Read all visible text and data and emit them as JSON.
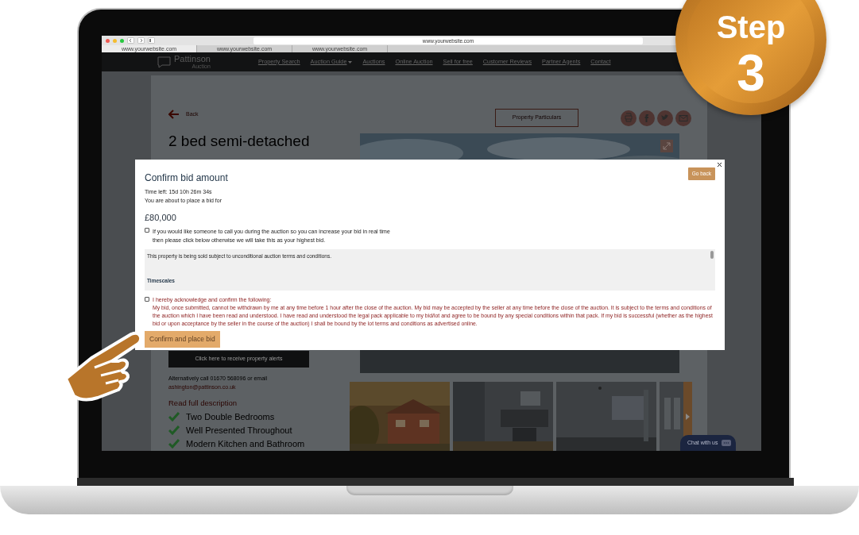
{
  "browser": {
    "url": "www.yourwebsite.com",
    "tabs": [
      {
        "label": "www.yourwebsite.com",
        "selected": true
      },
      {
        "label": "www.yourwebsite.com",
        "selected": false
      },
      {
        "label": "www.yourwebsite.com",
        "selected": false
      }
    ]
  },
  "site_nav": {
    "logo_name": "Pattinson",
    "logo_tagline": "Auction",
    "links": [
      {
        "label": "Property Search",
        "dropdown": false
      },
      {
        "label": "Auction Guide",
        "dropdown": true
      },
      {
        "label": "Auctions",
        "dropdown": false
      },
      {
        "label": "Online Auction",
        "dropdown": false
      },
      {
        "label": "Sell for free",
        "dropdown": false
      },
      {
        "label": "Customer Reviews",
        "dropdown": false
      },
      {
        "label": "Partner Agents",
        "dropdown": false
      },
      {
        "label": "Contact",
        "dropdown": false
      }
    ]
  },
  "listing": {
    "back": "Back",
    "particulars_button": "Property Particulars",
    "title": "2 bed semi-detached",
    "alerts_button": "Click here to receive property alerts",
    "contact_text": "Alternatively call 01670 568096 or email",
    "email": "ashington@pattinson.co.uk",
    "read_more": "Read full description",
    "features": [
      "Two Double Bedrooms",
      "Well Presented Throughout",
      "Modern Kitchen and Bathroom"
    ]
  },
  "chat": {
    "label": "Chat with us"
  },
  "modal": {
    "title": "Confirm bid amount",
    "go_back": "Go back",
    "time_left": "Time left: 15d 10h 26m 34s",
    "intro": "You are about to place a bid for",
    "amount": "£80,000",
    "call_option": {
      "text": "If you would like someone to call you during the auction so you can increase your bid in real time then please click below otherwise we will take this as your highest bid.",
      "checked": false
    },
    "terms": {
      "text": "This property is being sold subject to unconditional auction terms and conditions.",
      "heading": "Timescales"
    },
    "acknowledge": {
      "heading": "I hereby acknowledge and confirm the following:",
      "text": "My bid, once submitted, cannot be withdrawn by me at any time before 1 hour after the close of the auction. My bid may be accepted by the seller at any time before the close of the auction.  It is subject to the terms and conditions of the auction which I have been read and understood. I have read and understood the legal pack applicable to my bid/lot and agree to be bound by any special conditions within that pack. If my bid is successful (whether as the highest bid or upon acceptance by the seller in the course of the auction) I shall be bound by the lot terms and conditions as advertised online.",
      "checked": false
    },
    "confirm_button": "Confirm and place bid"
  },
  "step_badge": {
    "word": "Step",
    "number": "3"
  }
}
